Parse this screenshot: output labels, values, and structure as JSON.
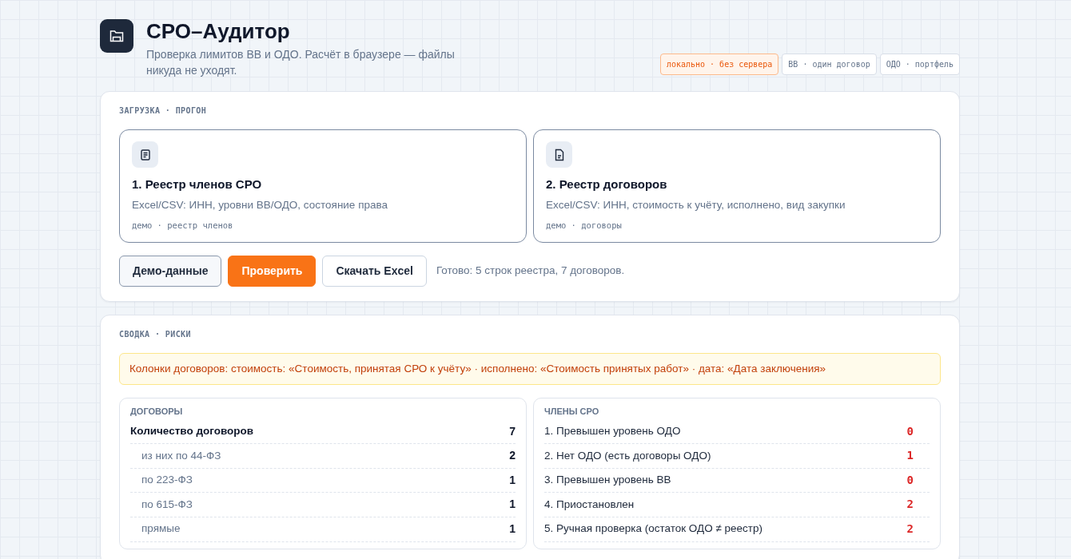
{
  "app": {
    "title": "СРО–Аудитор",
    "subtitle": "Проверка лимитов ВВ и ОДО. Расчёт в браузере — файлы никуда не уходят."
  },
  "badges": [
    {
      "label": "локально · без сервера",
      "kind": "accent"
    },
    {
      "label": "ВВ · один договор",
      "kind": "plain"
    },
    {
      "label": "ОДО · портфель",
      "kind": "plain"
    }
  ],
  "upload_section": {
    "heading": "ЗАГРУЗКА · ПРОГОН",
    "files": [
      {
        "title": "1. Реестр членов СРО",
        "description": "Excel/CSV: ИНН, уровни ВВ/ОДО, состояние права",
        "hint": "демо · реестр членов",
        "kind": "list"
      },
      {
        "title": "2. Реестр договоров",
        "description": "Excel/CSV: ИНН, стоимость к учёту, исполнено, вид закупки",
        "hint": "демо · договоры",
        "kind": "doc"
      }
    ],
    "buttons": [
      {
        "label": "Демо-данные",
        "kind": "secondary"
      },
      {
        "label": "Проверить",
        "kind": "primary"
      },
      {
        "label": "Скачать Excel",
        "kind": "outline"
      }
    ],
    "status": "Готово: 5 строк реестра, 7 договоров."
  },
  "summary_section": {
    "heading": "СВОДКА · РИСКИ",
    "notice": "Колонки договоров: стоимость: «Стоимость, принятая СРО к учёту» · исполнено: «Стоимость принятых работ» · дата: «Дата заключения»",
    "panels": [
      {
        "heading": "ДОГОВОРЫ",
        "rows": [
          {
            "label": "Количество договоров",
            "value": "7",
            "kind": "total"
          },
          {
            "label": "из них по 44-ФЗ",
            "value": "2",
            "kind": "sub"
          },
          {
            "label": "по 223-ФЗ",
            "value": "1",
            "kind": "sub"
          },
          {
            "label": "по 615-ФЗ",
            "value": "1",
            "kind": "sub"
          },
          {
            "label": "прямые",
            "value": "1",
            "kind": "sub"
          }
        ]
      },
      {
        "heading": "ЧЛЕНЫ СРО",
        "rows": [
          {
            "label": "1. Превышен уровень ОДО",
            "value": "0",
            "kind": "risk"
          },
          {
            "label": "2. Нет ОДО (есть договоры ОДО)",
            "value": "1",
            "kind": "risk"
          },
          {
            "label": "3. Превышен уровень ВВ",
            "value": "0",
            "kind": "risk"
          },
          {
            "label": "4. Приостановлен",
            "value": "2",
            "kind": "risk"
          },
          {
            "label": "5. Ручная проверка (остаток ОДО ≠ реестр)",
            "value": "2",
            "kind": "risk"
          }
        ]
      }
    ]
  }
}
